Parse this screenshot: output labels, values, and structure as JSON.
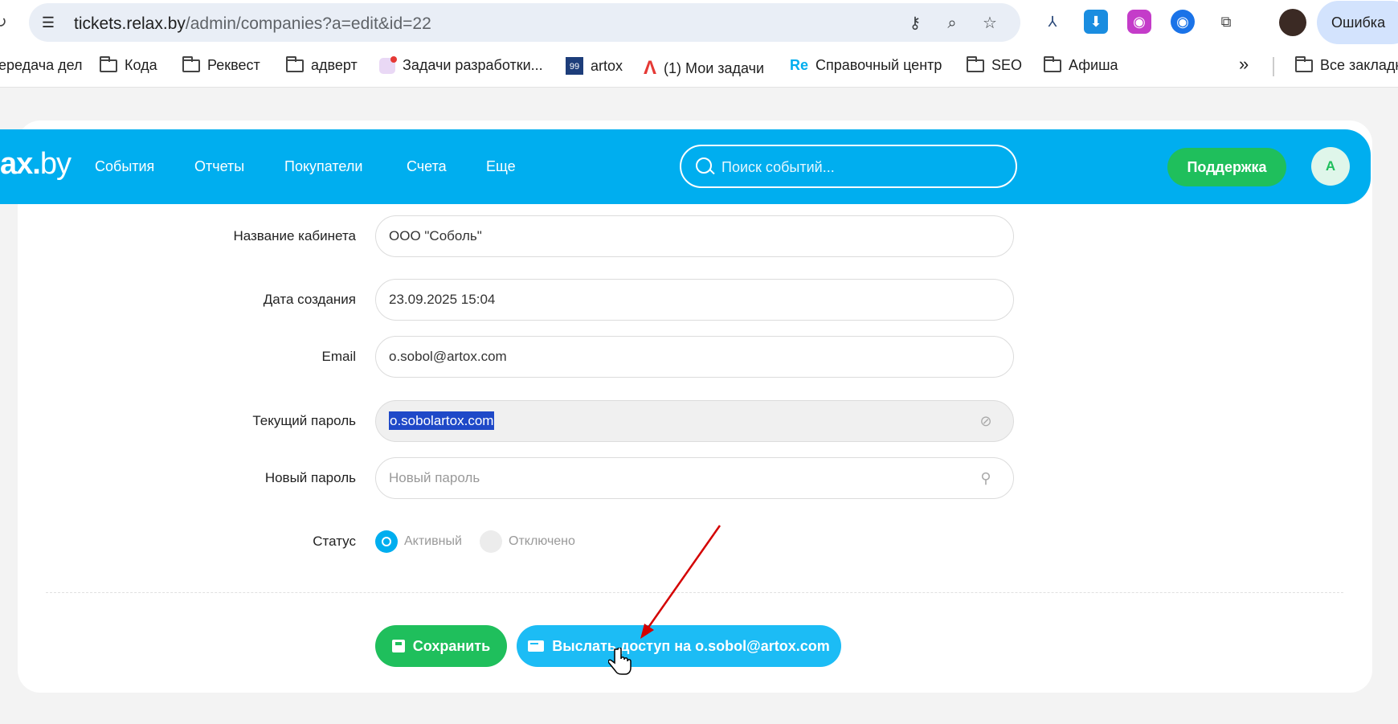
{
  "browser": {
    "url_host": "tickets.relax.by",
    "url_path": "/admin/companies?a=edit&id=22",
    "profile_status": "Ошибка",
    "icons": [
      "tune-icon",
      "key-icon",
      "zoom-icon",
      "star-icon",
      "extension-icons",
      "puzzle-icon"
    ]
  },
  "bookmarks": [
    {
      "label": "ередача дел",
      "icon": "none"
    },
    {
      "label": "Кода",
      "icon": "folder-icon"
    },
    {
      "label": "Реквест",
      "icon": "folder-icon"
    },
    {
      "label": "адверт",
      "icon": "folder-icon"
    },
    {
      "label": "Задачи разработки...",
      "icon": "app-icon"
    },
    {
      "label": "artox",
      "icon": "artox-icon"
    },
    {
      "label": "(1) Мои задачи",
      "icon": "a-icon"
    },
    {
      "label": "Справочный центр",
      "icon": "re-icon"
    },
    {
      "label": "SEO",
      "icon": "folder-icon"
    },
    {
      "label": "Афиша",
      "icon": "folder-icon"
    },
    {
      "label": "Все закладк",
      "icon": "folder-icon"
    }
  ],
  "bookmark_badges": {
    "artox": "99",
    "re": "Re"
  },
  "header": {
    "logo_bold": "ax.",
    "logo_thin": "by",
    "nav": [
      "События",
      "Отчеты",
      "Покупатели",
      "Счета",
      "Еще"
    ],
    "search_placeholder": "Поиск событий...",
    "support_label": "Поддержка",
    "user_initial": "A"
  },
  "form": {
    "cabinet_name_label": "Название кабинета",
    "cabinet_name_value": "ООО \"Соболь\"",
    "created_label": "Дата создания",
    "created_value": "23.09.2025 15:04",
    "email_label": "Email",
    "email_value": "o.sobol@artox.com",
    "current_password_label": "Текущий пароль",
    "current_password_value": "o.sobolartox.com",
    "new_password_label": "Новый пароль",
    "new_password_placeholder": "Новый пароль",
    "status_label": "Статус",
    "status_active": "Активный",
    "status_disabled": "Отключено",
    "status_selected": "Активный"
  },
  "actions": {
    "save_label": "Сохранить",
    "send_access_label": "Выслать доступ на o.sobol@artox.com"
  },
  "colors": {
    "brand": "#00aeef",
    "green": "#1fbf5c",
    "send_button": "#1cbcf5",
    "annotation_arrow": "#d40000"
  }
}
